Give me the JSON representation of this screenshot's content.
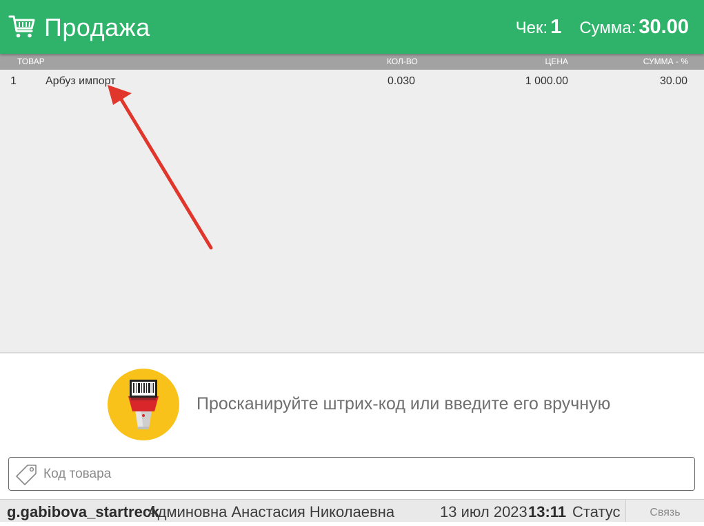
{
  "header": {
    "title": "Продажа",
    "receipt_label": "Чек:",
    "receipt_number": "1",
    "sum_label": "Сумма:",
    "sum_value": "30.00",
    "background_color": "#2fb36b",
    "cart_icon": "cart-icon"
  },
  "table": {
    "columns": {
      "item": "ТОВАР",
      "qty": "КОЛ-ВО",
      "price": "ЦЕНА",
      "sum": "СУММА - %"
    },
    "rows": [
      {
        "num": "1",
        "name": "Арбуз импорт",
        "qty": "0.030",
        "price": "1 000.00",
        "sum": "30.00"
      }
    ],
    "annotation_color": "#e0362c"
  },
  "scan": {
    "icon": "barcode-scanner-icon",
    "hint": "Просканируйте штрих-код или введите его вручную"
  },
  "code_input": {
    "icon": "tag-icon",
    "placeholder": "Код товара",
    "value": ""
  },
  "statusbar": {
    "login": "g.gabibova_startreck",
    "user_name": "Админовна Анастасия Николаевна",
    "date": "13 июл 2023",
    "time": "13:11",
    "status_label": "Статус",
    "connection_button": "Связь"
  }
}
